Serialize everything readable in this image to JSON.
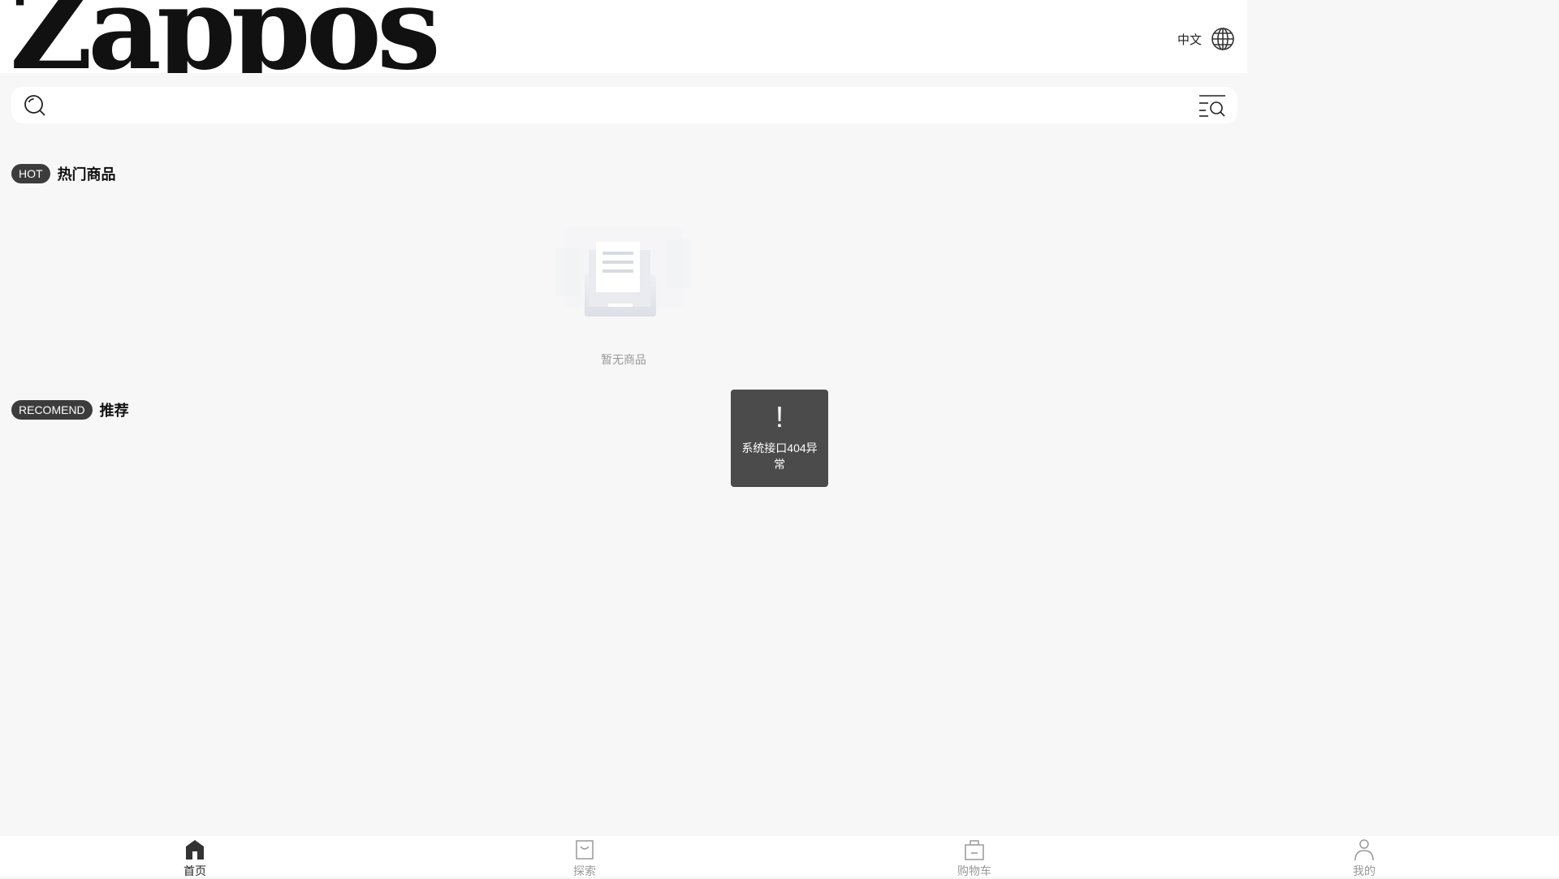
{
  "header": {
    "logo_text": "Zappos",
    "language_label": "中文"
  },
  "search": {
    "placeholder": "",
    "value": ""
  },
  "sections": {
    "hot": {
      "badge": "HOT",
      "title": "热门商品",
      "empty_text": "暂无商品"
    },
    "recommend": {
      "badge": "RECOMEND",
      "title": "推荐"
    }
  },
  "toast": {
    "icon": "!",
    "message": "系统接口404异常"
  },
  "tabbar": {
    "items": [
      {
        "label": "首页",
        "icon": "home-icon",
        "active": true
      },
      {
        "label": "探索",
        "icon": "shopping-bag-icon",
        "active": false
      },
      {
        "label": "购物车",
        "icon": "cart-icon",
        "active": false
      },
      {
        "label": "我的",
        "icon": "user-icon",
        "active": false
      }
    ]
  },
  "colors": {
    "page_background": "#f7f7f7",
    "badge_background": "#3c3c3c",
    "toast_background": "#4b4b4b",
    "muted_text": "#999999"
  }
}
